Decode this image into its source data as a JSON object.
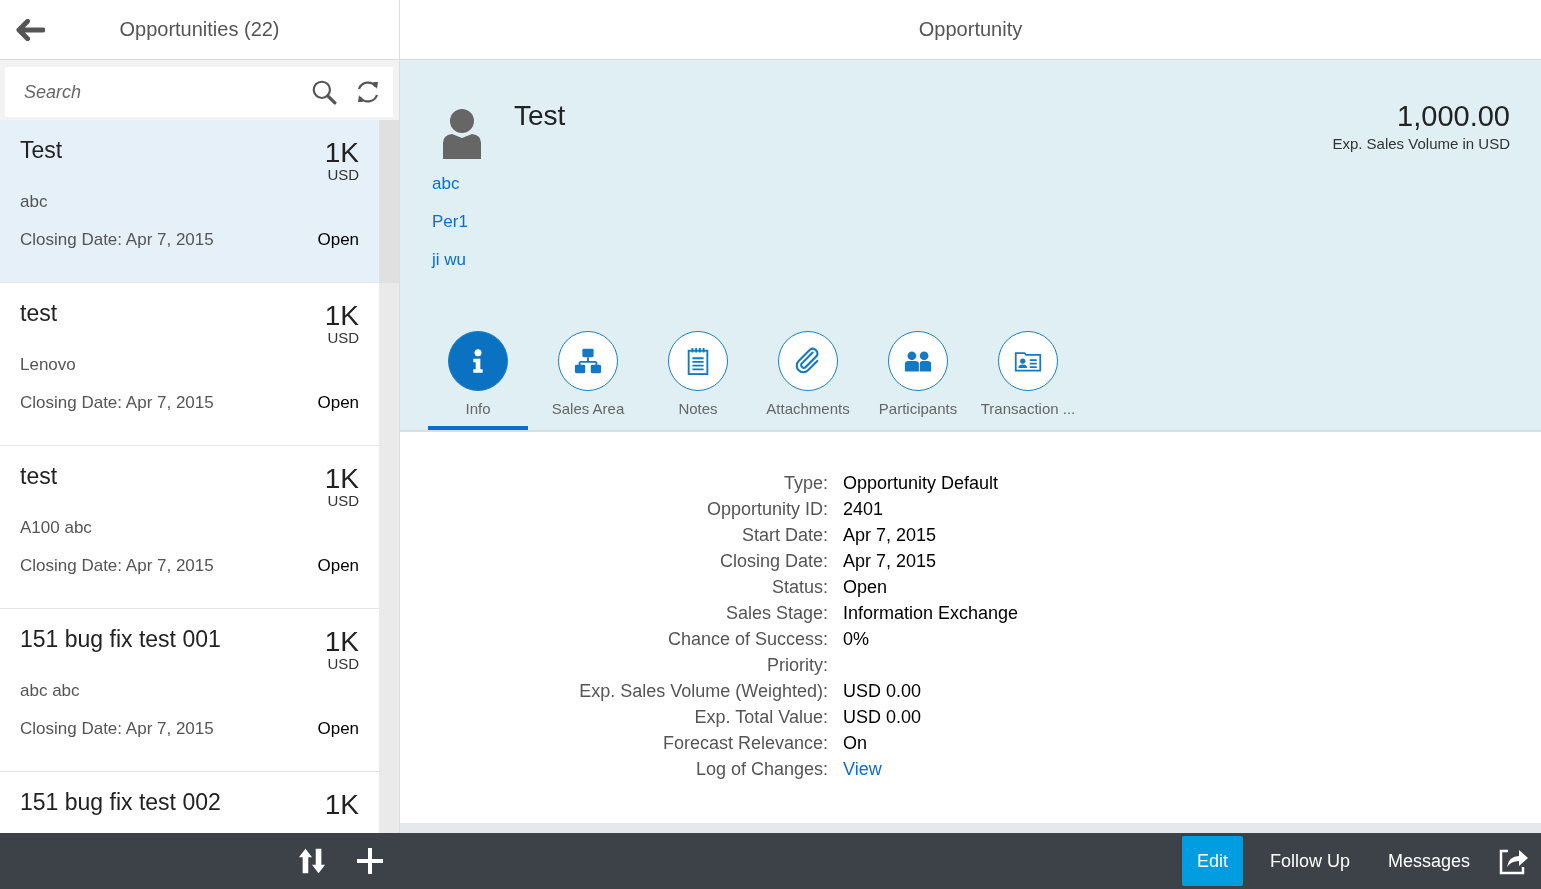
{
  "list_header": {
    "title": "Opportunities (22)"
  },
  "search": {
    "placeholder": "Search"
  },
  "opportunities": [
    {
      "title": "Test",
      "amount": "1K",
      "currency": "USD",
      "account": "abc",
      "closing": "Closing Date: Apr 7, 2015",
      "status": "Open",
      "selected": true
    },
    {
      "title": "test",
      "amount": "1K",
      "currency": "USD",
      "account": "Lenovo",
      "closing": "Closing Date: Apr 7, 2015",
      "status": "Open",
      "selected": false
    },
    {
      "title": "test",
      "amount": "1K",
      "currency": "USD",
      "account": "A100 abc",
      "closing": "Closing Date: Apr 7, 2015",
      "status": "Open",
      "selected": false
    },
    {
      "title": "151 bug fix test 001",
      "amount": "1K",
      "currency": "USD",
      "account": "abc abc",
      "closing": "Closing Date: Apr 7, 2015",
      "status": "Open",
      "selected": false
    },
    {
      "title": "151 bug fix test 002",
      "amount": "1K",
      "selected": false
    }
  ],
  "detail": {
    "title": "Opportunity",
    "name": "Test",
    "links": [
      "abc",
      "Per1",
      "ji wu"
    ],
    "amount": "1,000.00",
    "amount_label": "Exp. Sales Volume in USD",
    "tabs": [
      {
        "label": "Info",
        "kind": "info",
        "selected": true
      },
      {
        "label": "Sales Area",
        "kind": "hierarchy",
        "selected": false
      },
      {
        "label": "Notes",
        "kind": "notes",
        "selected": false
      },
      {
        "label": "Attachments",
        "kind": "attachment",
        "selected": false
      },
      {
        "label": "Participants",
        "kind": "people",
        "selected": false
      },
      {
        "label": "Transaction ...",
        "kind": "card",
        "selected": false
      }
    ],
    "fields": [
      {
        "label": "Type:",
        "value": "Opportunity Default",
        "kind": "text"
      },
      {
        "label": "Opportunity ID:",
        "value": "2401",
        "kind": "text"
      },
      {
        "label": "Start Date:",
        "value": "Apr 7, 2015",
        "kind": "text"
      },
      {
        "label": "Closing Date:",
        "value": "Apr 7, 2015",
        "kind": "text"
      },
      {
        "label": "Status:",
        "value": "Open",
        "kind": "text"
      },
      {
        "label": "Sales Stage:",
        "value": "Information Exchange",
        "kind": "text"
      },
      {
        "label": "Chance of Success:",
        "value": "0%",
        "kind": "text"
      },
      {
        "label": "Priority:",
        "kind": "text"
      },
      {
        "label": "Exp. Sales Volume (Weighted):",
        "value": "USD 0.00",
        "kind": "text"
      },
      {
        "label": "Exp. Total Value:",
        "value": "USD 0.00",
        "kind": "text"
      },
      {
        "label": "Forecast Relevance:",
        "value": "On",
        "kind": "text"
      },
      {
        "label": "Log of Changes:",
        "value": "View",
        "kind": "link"
      }
    ]
  },
  "footer": {
    "buttons": [
      {
        "label": "Edit",
        "kind": "primary"
      },
      {
        "label": "Follow Up",
        "kind": "plain"
      },
      {
        "label": "Messages",
        "kind": "plain"
      }
    ]
  }
}
